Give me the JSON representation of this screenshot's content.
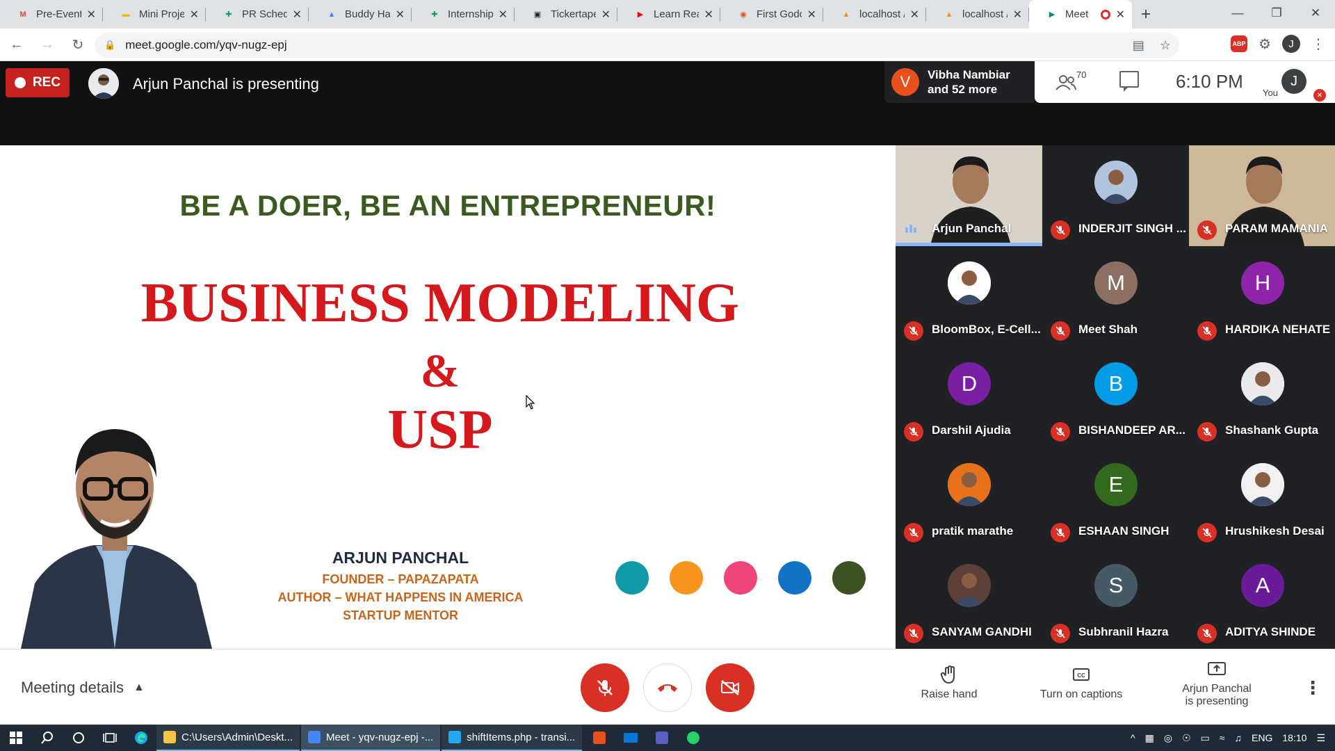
{
  "browser": {
    "tabs": [
      {
        "title": "Pre-Event",
        "icon": "gmail-icon",
        "color": "#ea4335"
      },
      {
        "title": "Mini Proje",
        "icon": "slides-icon",
        "color": "#f4b400"
      },
      {
        "title": "PR Schedu",
        "icon": "sheets-icon",
        "color": "#0f9d58"
      },
      {
        "title": "Buddy Ha",
        "icon": "drive-icon",
        "color": "#4285f4"
      },
      {
        "title": "Internship",
        "icon": "sheets-icon",
        "color": "#0f9d58"
      },
      {
        "title": "Tickertape",
        "icon": "tickertape-icon",
        "color": "#202124"
      },
      {
        "title": "Learn Rea",
        "icon": "youtube-icon",
        "color": "#ff0000"
      },
      {
        "title": "First Godc",
        "icon": "godot-icon",
        "color": "#e8501c"
      },
      {
        "title": "localhost /",
        "icon": "phpmyadmin-icon",
        "color": "#f29111"
      },
      {
        "title": "localhost /",
        "icon": "phpmyadmin-icon",
        "color": "#f29111"
      },
      {
        "title": "Meet",
        "icon": "meet-icon",
        "color": "#00897b",
        "active": true
      }
    ],
    "url": "meet.google.com/yqv-nugz-epj",
    "profile_initial": "J",
    "abp_label": "ABP"
  },
  "meet": {
    "rec_label": "REC",
    "presenting_text": "Arjun Panchal is presenting",
    "viewer_initial": "V",
    "viewer_line1": "Vibha Nambiar",
    "viewer_line2": "and 52 more",
    "people_count": "70",
    "time": "6:10 PM",
    "you_label": "You",
    "you_initial": "J"
  },
  "slide": {
    "tagline": "BE A DOER, BE AN ENTREPRENEUR!",
    "title_line1": "BUSINESS MODELING",
    "title_line2": "&",
    "title_line3": "USP",
    "presenter_name": "ARJUN PANCHAL",
    "line1": "FOUNDER – PAPAZAPATA",
    "line2": "AUTHOR – WHAT HAPPENS IN AMERICA",
    "line3": "STARTUP MENTOR",
    "dot_colors": [
      "#0e9aa7",
      "#f7941d",
      "#f0457a",
      "#1272c4",
      "#3a5320"
    ]
  },
  "participants": [
    {
      "name": "Arjun Panchal",
      "type": "video",
      "speaking": true,
      "bg": "#d9d2c8"
    },
    {
      "name": "INDERJIT SINGH ...",
      "type": "photo",
      "bg": "#b0c4de",
      "muted": true
    },
    {
      "name": "PARAM MAMANIA",
      "type": "video",
      "bg": "#cdb89a",
      "muted": true
    },
    {
      "name": "BloomBox, E-Cell...",
      "type": "photo",
      "bg": "#ffffff",
      "muted": true
    },
    {
      "name": "Meet Shah",
      "type": "initial",
      "initial": "M",
      "bg": "#8d6e63",
      "muted": true
    },
    {
      "name": "HARDIKA NEHATE",
      "type": "initial",
      "initial": "H",
      "bg": "#8e24aa",
      "muted": true
    },
    {
      "name": "Darshil Ajudia",
      "type": "initial",
      "initial": "D",
      "bg": "#7b1fa2",
      "muted": true
    },
    {
      "name": "BISHANDEEP AR...",
      "type": "initial",
      "initial": "B",
      "bg": "#039be5",
      "muted": true
    },
    {
      "name": "Shashank Gupta",
      "type": "photo",
      "bg": "#e8eaed",
      "muted": true
    },
    {
      "name": "pratik marathe",
      "type": "photo",
      "bg": "#e8711c",
      "muted": true
    },
    {
      "name": "ESHAAN SINGH",
      "type": "initial",
      "initial": "E",
      "bg": "#33691e",
      "muted": true
    },
    {
      "name": "Hrushikesh Desai",
      "type": "photo",
      "bg": "#f1f1f1",
      "muted": true
    },
    {
      "name": "SANYAM GANDHI",
      "type": "photo",
      "bg": "#5d4037",
      "muted": true
    },
    {
      "name": "Subhranil Hazra",
      "type": "initial",
      "initial": "S",
      "bg": "#455a64",
      "muted": true
    },
    {
      "name": "ADITYA SHINDE",
      "type": "initial",
      "initial": "A",
      "bg": "#6a1b9a",
      "muted": true
    }
  ],
  "controls": {
    "meeting_details": "Meeting details",
    "raise_hand": "Raise hand",
    "captions": "Turn on captions",
    "presenting_line1": "Arjun Panchal",
    "presenting_line2": "is presenting"
  },
  "taskbar": {
    "apps": [
      {
        "label": "C:\\Users\\Admin\\Deskt...",
        "icon": "folder-icon",
        "color": "#f4c542"
      },
      {
        "label": "Meet - yqv-nugz-epj -...",
        "icon": "chrome-icon",
        "color": "#4285f4",
        "active": true
      },
      {
        "label": "shiftItems.php - transi...",
        "icon": "vscode-icon",
        "color": "#23a9f2"
      }
    ],
    "lang": "ENG",
    "clock": "18:10"
  }
}
